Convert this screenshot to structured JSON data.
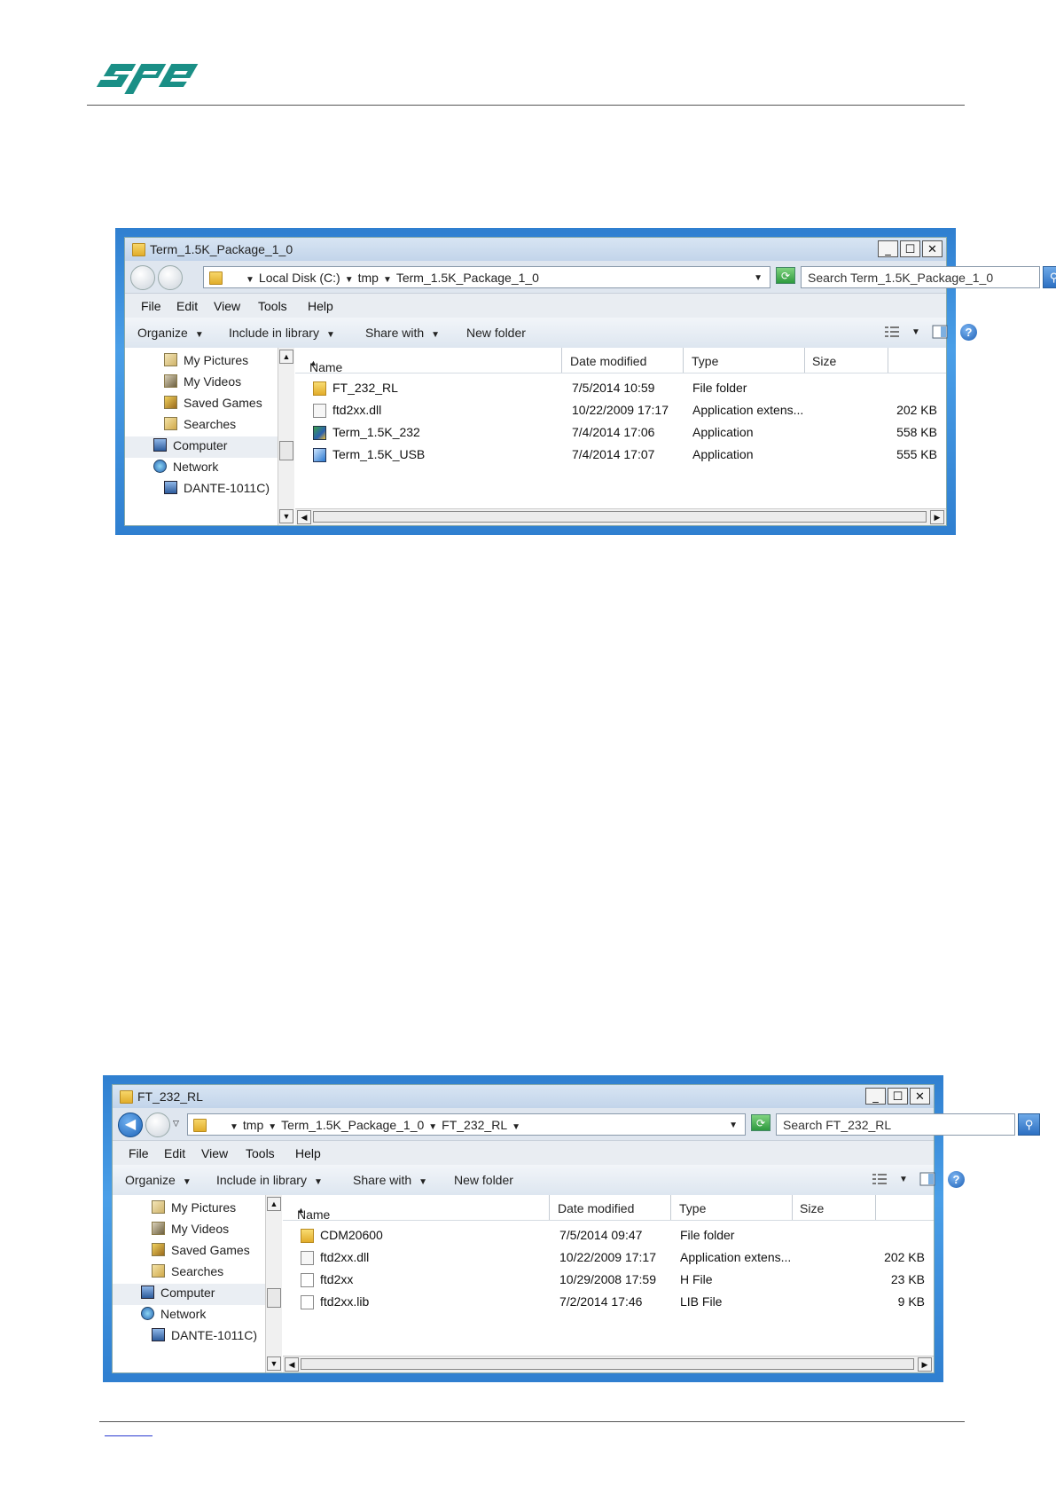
{
  "logo_text": "spe",
  "windows": [
    {
      "title": "Term_1.5K_Package_1_0",
      "crumbs": [
        "Local Disk (C:)",
        "tmp",
        "Term_1.5K_Package_1_0"
      ],
      "search_placeholder": "Search Term_1.5K_Package_1_0",
      "menu": [
        "File",
        "Edit",
        "View",
        "Tools",
        "Help"
      ],
      "toolbar": {
        "organize": "Organize",
        "include": "Include in library",
        "share": "Share with",
        "new_folder": "New folder"
      },
      "nav": [
        "My Pictures",
        "My Videos",
        "Saved Games",
        "Searches",
        "Computer",
        "Network",
        "DANTE-1011C)"
      ],
      "columns": {
        "name": "Name",
        "date": "Date modified",
        "type": "Type",
        "size": "Size"
      },
      "files": [
        {
          "name": "FT_232_RL",
          "date": "7/5/2014 10:59",
          "type": "File folder",
          "size": "",
          "icon": "folder-icon"
        },
        {
          "name": "ftd2xx.dll",
          "date": "10/22/2009 17:17",
          "type": "Application extens...",
          "size": "202 KB",
          "icon": "dll-file-icon"
        },
        {
          "name": "Term_1.5K_232",
          "date": "7/4/2014 17:06",
          "type": "Application",
          "size": "558 KB",
          "icon": "application-icon"
        },
        {
          "name": "Term_1.5K_USB",
          "date": "7/4/2014 17:07",
          "type": "Application",
          "size": "555 KB",
          "icon": "application-icon"
        }
      ]
    },
    {
      "title": "FT_232_RL",
      "crumbs": [
        "tmp",
        "Term_1.5K_Package_1_0",
        "FT_232_RL"
      ],
      "search_placeholder": "Search FT_232_RL",
      "menu": [
        "File",
        "Edit",
        "View",
        "Tools",
        "Help"
      ],
      "toolbar": {
        "organize": "Organize",
        "include": "Include in library",
        "share": "Share with",
        "new_folder": "New folder"
      },
      "nav": [
        "My Pictures",
        "My Videos",
        "Saved Games",
        "Searches",
        "Computer",
        "Network",
        "DANTE-1011C)"
      ],
      "columns": {
        "name": "Name",
        "date": "Date modified",
        "type": "Type",
        "size": "Size"
      },
      "files": [
        {
          "name": "CDM20600",
          "date": "7/5/2014 09:47",
          "type": "File folder",
          "size": "",
          "icon": "folder-icon"
        },
        {
          "name": "ftd2xx.dll",
          "date": "10/22/2009 17:17",
          "type": "Application extens...",
          "size": "202 KB",
          "icon": "dll-file-icon"
        },
        {
          "name": "ftd2xx",
          "date": "10/29/2008 17:59",
          "type": "H File",
          "size": "23 KB",
          "icon": "file-icon"
        },
        {
          "name": "ftd2xx.lib",
          "date": "7/2/2014 17:46",
          "type": "LIB File",
          "size": "9 KB",
          "icon": "file-icon"
        }
      ]
    }
  ]
}
